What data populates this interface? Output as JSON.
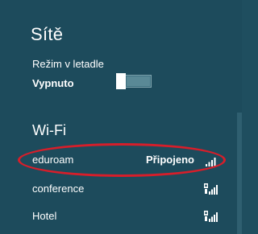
{
  "panel": {
    "title": "Sítě"
  },
  "airplane_mode": {
    "label": "Režim v letadle",
    "state": "Vypnuto",
    "enabled": false
  },
  "wifi": {
    "section_title": "Wi-Fi",
    "networks": [
      {
        "name": "eduroam",
        "status": "Připojeno",
        "secured": false,
        "signal_icon": "signal-bars-icon"
      },
      {
        "name": "conference",
        "status": "",
        "secured": true,
        "signal_icon": "secured-signal-icon"
      },
      {
        "name": "Hotel",
        "status": "",
        "secured": true,
        "signal_icon": "secured-signal-icon"
      }
    ]
  },
  "colors": {
    "background": "#1d4b5c",
    "highlight_oval": "#d71e2a",
    "text": "#ffffff"
  }
}
